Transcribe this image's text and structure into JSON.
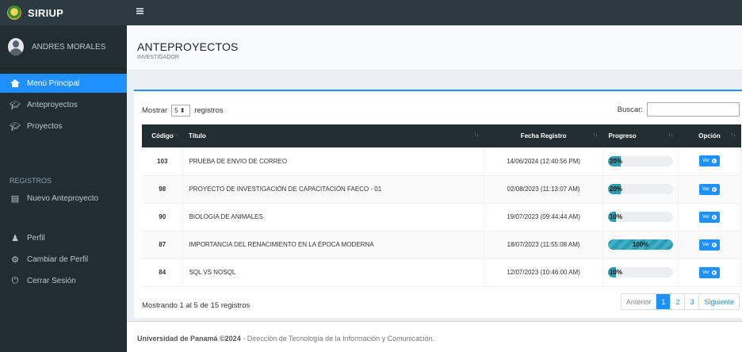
{
  "app": {
    "name": "SIRIUP"
  },
  "user": {
    "name": "ANDRES MORALES"
  },
  "sidebar": {
    "items": [
      {
        "label": "Menú Principal",
        "icon": "home-icon",
        "active": true
      },
      {
        "label": "Anteproyectos",
        "icon": "graduation-cap-icon"
      },
      {
        "label": "Proyectos",
        "icon": "graduation-cap-icon"
      }
    ],
    "section_header": "REGISTROS",
    "registros": [
      {
        "label": "Nuevo Anteproyecto",
        "icon": "document-icon"
      }
    ],
    "account": [
      {
        "label": "Perfil",
        "icon": "user-icon"
      },
      {
        "label": "Cambiar de Perfil",
        "icon": "cogs-icon"
      },
      {
        "label": "Cerrar Sesión",
        "icon": "power-icon"
      }
    ]
  },
  "header": {
    "title": "ANTEPROYECTOS",
    "subtitle": "INVESTIGADOR"
  },
  "table_controls": {
    "show_prefix": "Mostrar",
    "page_size": "5",
    "show_suffix": "registros",
    "search_label": "Buscar:",
    "search_value": ""
  },
  "table": {
    "columns": [
      "Código",
      "Título",
      "Fecha Registro",
      "Progreso",
      "Opción"
    ],
    "rows": [
      {
        "code": "103",
        "title": "PRUEBA DE ENVIO DE CORREO",
        "date": "14/06/2024 (12:40:56 PM)",
        "progress": 20,
        "progress_label": "20%",
        "action": "Ver"
      },
      {
        "code": "98",
        "title": "PROYECTO DE INVESTIGACIÓN DE CAPACITACIÓN FAECO - 01",
        "date": "02/08/2023 (11:13:07 AM)",
        "progress": 20,
        "progress_label": "20%",
        "action": "Ver"
      },
      {
        "code": "90",
        "title": "BIOLOGIA DE ANIMALES",
        "date": "19/07/2023 (09:44:44 AM)",
        "progress": 10,
        "progress_label": "10%",
        "action": "Ver"
      },
      {
        "code": "87",
        "title": "IMPORTANCIA DEL RENACIMIENTO EN LA ÉPOCA MODERNA",
        "date": "18/07/2023 (11:55:08 AM)",
        "progress": 100,
        "progress_label": "100%",
        "action": "Ver"
      },
      {
        "code": "84",
        "title": "SQL VS NOSQL",
        "date": "12/07/2023 (10:46:00 AM)",
        "progress": 10,
        "progress_label": "10%",
        "action": "Ver"
      }
    ]
  },
  "pagination": {
    "info": "Mostrando 1 al 5 de 15 registros",
    "previous": "Anterior",
    "pages": [
      "1",
      "2",
      "3"
    ],
    "current_page": "1",
    "next": "Siguiente"
  },
  "footer": {
    "brand": "Universidad de Panamá ©2024",
    "text": " - Dirección de Tecnología de la Información y Comunicación."
  },
  "colors": {
    "accent": "#1e90ff",
    "sidebar": "#222d32",
    "progress": "#2a9db3"
  }
}
